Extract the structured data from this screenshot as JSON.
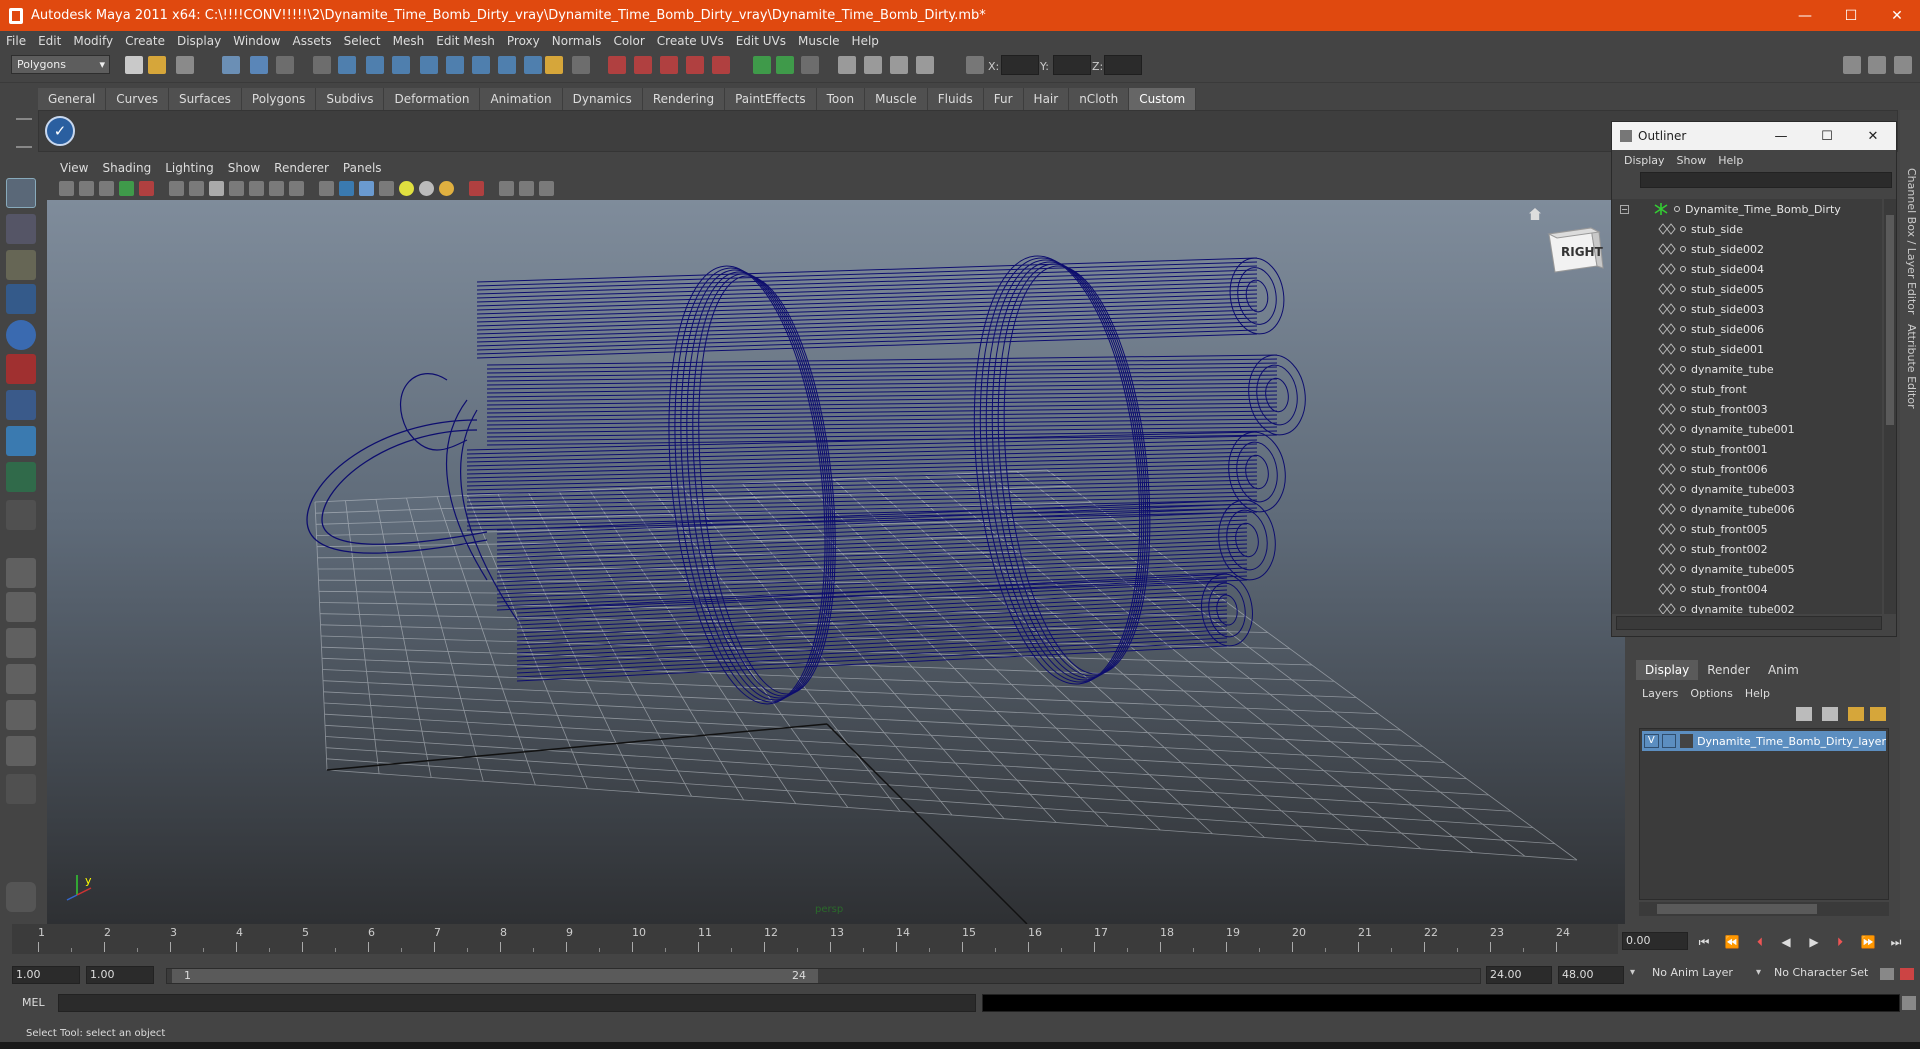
{
  "window": {
    "title": "Autodesk Maya 2011 x64: C:\\!!!!CONV!!!!!\\2\\Dynamite_Time_Bomb_Dirty_vray\\Dynamite_Time_Bomb_Dirty_vray\\Dynamite_Time_Bomb_Dirty.mb*",
    "minimize": "—",
    "maximize": "☐",
    "close": "✕"
  },
  "menubar": [
    "File",
    "Edit",
    "Modify",
    "Create",
    "Display",
    "Window",
    "Assets",
    "Select",
    "Mesh",
    "Edit Mesh",
    "Proxy",
    "Normals",
    "Color",
    "Create UVs",
    "Edit UVs",
    "Muscle",
    "Help"
  ],
  "statusline": {
    "mode": "Polygons",
    "coord_x": "X:",
    "coord_y": "Y:",
    "coord_z": "Z:"
  },
  "shelf": {
    "tabs": [
      "General",
      "Curves",
      "Surfaces",
      "Polygons",
      "Subdivs",
      "Deformation",
      "Animation",
      "Dynamics",
      "Rendering",
      "PaintEffects",
      "Toon",
      "Muscle",
      "Fluids",
      "Fur",
      "Hair",
      "nCloth",
      "Custom"
    ],
    "active_tab": "Custom",
    "button_icon": "checkmark-icon"
  },
  "panel": {
    "menu": [
      "View",
      "Shading",
      "Lighting",
      "Show",
      "Renderer",
      "Panels"
    ],
    "camera_label": "persp",
    "viewcube_label": "RIGHT",
    "wire_color": "#0d0d6e",
    "axis": {
      "x": "x",
      "y": "y"
    }
  },
  "outliner": {
    "title": "Outliner",
    "menu": [
      "Display",
      "Show",
      "Help"
    ],
    "root": "Dynamite_Time_Bomb_Dirty",
    "items": [
      "stub_side",
      "stub_side002",
      "stub_side004",
      "stub_side005",
      "stub_side003",
      "stub_side006",
      "stub_side001",
      "dynamite_tube",
      "stub_front",
      "stub_front003",
      "dynamite_tube001",
      "stub_front001",
      "stub_front006",
      "dynamite_tube003",
      "dynamite_tube006",
      "stub_front005",
      "stub_front002",
      "dynamite_tube005",
      "stub_front004",
      "dynamite_tube002"
    ]
  },
  "right_tabs": {
    "channel_box": "Channel Box / Layer Editor",
    "attribute_editor": "Attribute Editor"
  },
  "layer_editor": {
    "tabs": [
      "Display",
      "Render",
      "Anim"
    ],
    "active_tab": "Display",
    "menu": [
      "Layers",
      "Options",
      "Help"
    ],
    "layer": {
      "visible": "V",
      "name": "Dynamite_Time_Bomb_Dirty_layer"
    }
  },
  "timeline": {
    "ticks": [
      "1",
      "2",
      "3",
      "4",
      "5",
      "6",
      "7",
      "8",
      "9",
      "10",
      "11",
      "12",
      "13",
      "14",
      "15",
      "16",
      "17",
      "18",
      "19",
      "20",
      "21",
      "22",
      "23",
      "24"
    ],
    "current_time": "0.00"
  },
  "range": {
    "start": "1.00",
    "playback_start": "1.00",
    "range_start_label": "1",
    "range_end_label": "24",
    "playback_end": "24.00",
    "end": "48.00",
    "anim_layer": "No Anim Layer",
    "char_set": "No Character Set"
  },
  "command": {
    "label": "MEL"
  },
  "help_line": "Select Tool: select an object"
}
